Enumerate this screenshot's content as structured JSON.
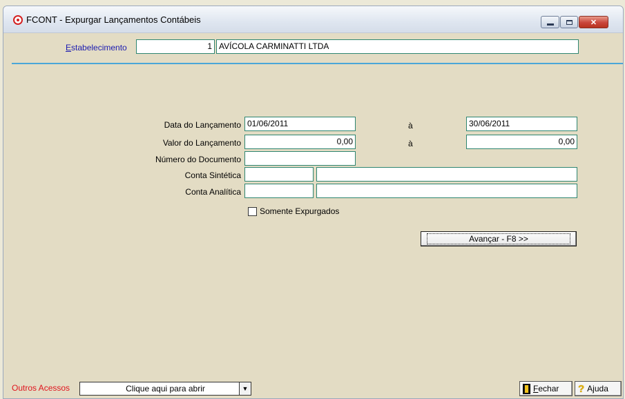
{
  "window": {
    "title": "FCONT - Expurgar Lançamentos Contábeis"
  },
  "estabelecimento": {
    "label_first": "E",
    "label_rest": "stabelecimento",
    "code": "1",
    "name": "AVÍCOLA CARMINATTI LTDA"
  },
  "form": {
    "data_label": "Data do Lançamento",
    "data_from": "01/06/2011",
    "data_sep": "à",
    "data_to": "30/06/2011",
    "valor_label": "Valor do Lançamento",
    "valor_from": "0,00",
    "valor_sep": "à",
    "valor_to": "0,00",
    "numero_label": "Número do Documento",
    "numero_value": "",
    "sintetica_label": "Conta Sintética",
    "sintetica_code": "",
    "sintetica_desc": "",
    "analitica_label": "Conta Analítica",
    "analitica_code": "",
    "analitica_desc": "",
    "somente_label": "Somente Expurgados",
    "avancar_label": "Avançar - F8 >>"
  },
  "bottom": {
    "outros_label": "Outros Acessos",
    "combo_value": "Clique aqui para abrir",
    "fechar_first": "F",
    "fechar_rest": "echar",
    "ajuda_label": "Ajuda"
  }
}
